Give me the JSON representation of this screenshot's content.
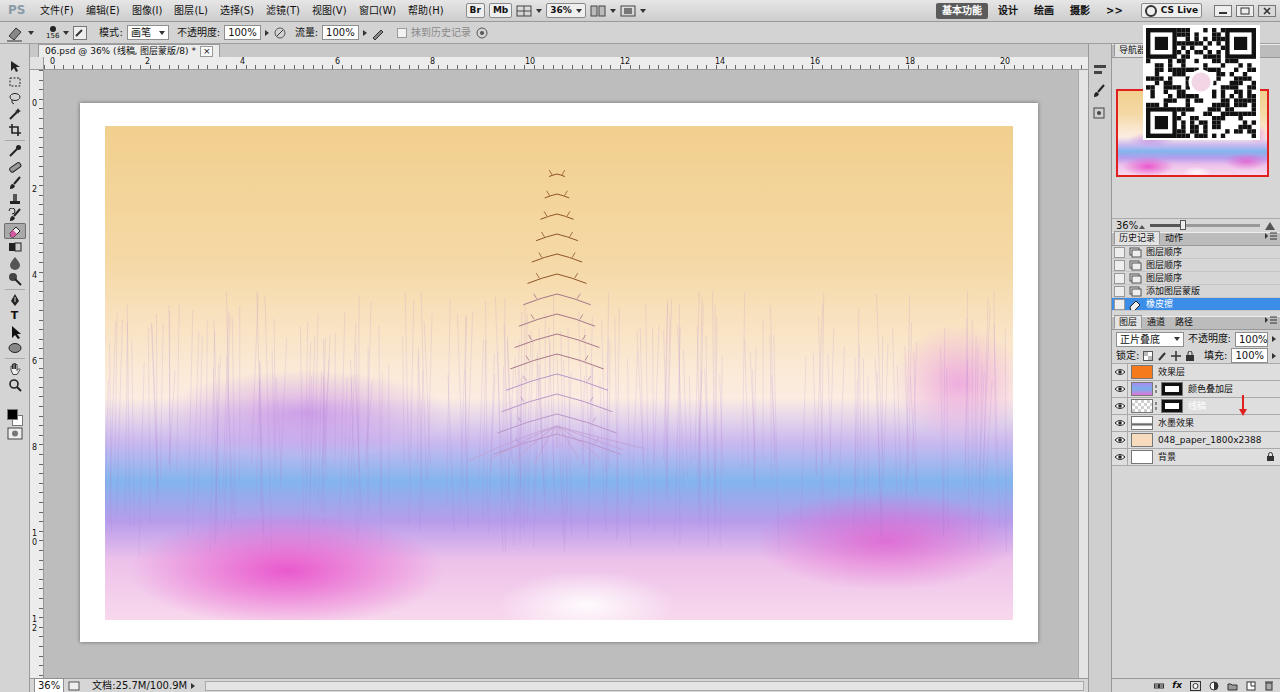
{
  "app_bar": {
    "logo": "PS",
    "menus": [
      "文件(F)",
      "编辑(E)",
      "图像(I)",
      "图层(L)",
      "选择(S)",
      "滤镜(T)",
      "视图(V)",
      "窗口(W)",
      "帮助(H)"
    ],
    "br": "Br",
    "mb": "Mb",
    "zoom": "36%",
    "workspaces": [
      {
        "label": "基本功能",
        "selected": true
      },
      {
        "label": "设计",
        "selected": false
      },
      {
        "label": "绘画",
        "selected": false
      },
      {
        "label": "摄影",
        "selected": false
      }
    ],
    "more": ">>",
    "cs_live": "CS Live"
  },
  "options": {
    "brush_size": "156",
    "mode_label": "模式:",
    "mode": "画笔",
    "opacity_label": "不透明度:",
    "opacity": "100%",
    "flow_label": "流量:",
    "flow": "100%",
    "erase_history": {
      "label": "抹到历史记录",
      "checked": false,
      "disabled": true
    }
  },
  "document": {
    "tab": "06.psd @ 36% (线稿, 图层蒙版/8) *",
    "close": "×"
  },
  "rulers": {
    "top": [
      "0",
      "2",
      "4",
      "6",
      "8",
      "10",
      "12",
      "14",
      "16",
      "18",
      "20"
    ],
    "left": [
      "0",
      "2",
      "4",
      "6",
      "8",
      "10",
      "12"
    ]
  },
  "tools": [
    {
      "kind": "move",
      "selected": false
    },
    {
      "kind": "marquee",
      "selected": false
    },
    {
      "kind": "lasso",
      "selected": false
    },
    {
      "kind": "wand",
      "selected": false
    },
    {
      "kind": "crop",
      "selected": false
    },
    {
      "kind": "eyedropper",
      "selected": false
    },
    {
      "kind": "heal",
      "selected": false
    },
    {
      "kind": "brush",
      "selected": false
    },
    {
      "kind": "stamp",
      "selected": false
    },
    {
      "kind": "histbrush",
      "selected": false
    },
    {
      "kind": "eraser",
      "selected": true
    },
    {
      "kind": "gradient",
      "selected": false
    },
    {
      "kind": "blur",
      "selected": false
    },
    {
      "kind": "dodge",
      "selected": false
    },
    {
      "kind": "pen",
      "selected": false
    },
    {
      "kind": "type",
      "label": "T",
      "selected": false
    },
    {
      "kind": "pathsel",
      "selected": false
    },
    {
      "kind": "shape",
      "selected": false
    },
    {
      "kind": "hand",
      "selected": false
    },
    {
      "kind": "zoom",
      "selected": false
    }
  ],
  "navigator": {
    "tab": "导航器",
    "zoom": "36%",
    "level": 0.3
  },
  "history": {
    "tabs": [
      {
        "label": "历史记录",
        "selected": true
      },
      {
        "label": "动作",
        "selected": false
      }
    ],
    "items": [
      {
        "label": "图层顺序",
        "selected": false
      },
      {
        "label": "图层顺序",
        "selected": false
      },
      {
        "label": "图层顺序",
        "selected": false
      },
      {
        "label": "添加图层蒙版",
        "selected": false
      },
      {
        "label": "橡皮擦",
        "selected": true
      }
    ]
  },
  "layers": {
    "tabs": [
      {
        "label": "图层",
        "selected": true
      },
      {
        "label": "通道",
        "selected": false
      },
      {
        "label": "路径",
        "selected": false
      }
    ],
    "blend": "正片叠底",
    "opacity_label": "不透明度:",
    "opacity": "100%",
    "lock_label": "锁定:",
    "fill_label": "填充:",
    "fill": "100%",
    "items": [
      {
        "name": "效果层",
        "visible": true,
        "selected": false,
        "kind": "solid",
        "color": "#f47a1c",
        "mask": false,
        "locked": false
      },
      {
        "name": "颜色叠加层",
        "visible": true,
        "selected": false,
        "kind": "gradient",
        "color": "#a88cf0",
        "mask": true,
        "locked": false
      },
      {
        "name": "线稿",
        "visible": true,
        "selected": true,
        "kind": "checker",
        "color": "#ffffff",
        "mask": true,
        "locked": false
      },
      {
        "name": "水墨效果",
        "visible": true,
        "selected": false,
        "kind": "ink",
        "color": "#555555",
        "mask": false,
        "locked": false
      },
      {
        "name": "048_paper_1800x2388",
        "visible": true,
        "selected": false,
        "kind": "solid",
        "color": "#f6dcbc",
        "mask": false,
        "locked": false
      },
      {
        "name": "背景",
        "visible": true,
        "selected": false,
        "kind": "solid",
        "color": "#ffffff",
        "mask": false,
        "locked": true
      }
    ],
    "footer_fx": "fx"
  },
  "status_bar": {
    "zoom": "36%",
    "doc": "文档:25.7M/100.9M"
  }
}
